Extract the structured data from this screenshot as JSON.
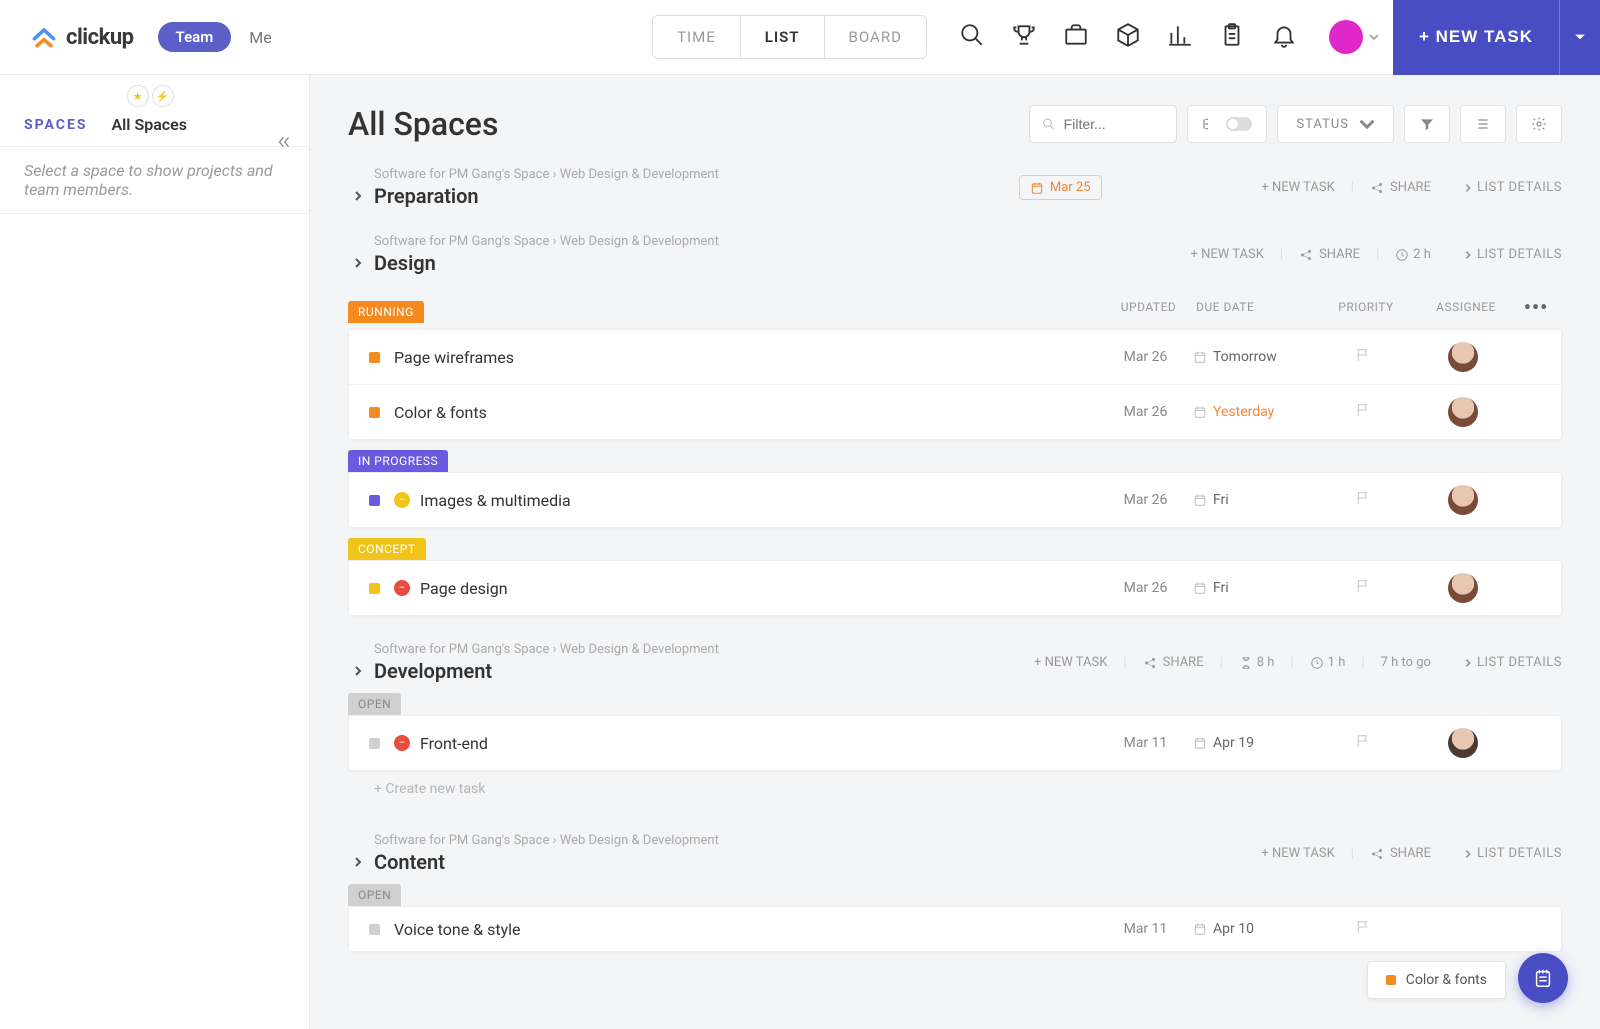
{
  "app": {
    "name": "clickup"
  },
  "topnav": {
    "team": "Team",
    "me": "Me",
    "views": [
      "TIME",
      "LIST",
      "BOARD"
    ],
    "active_view": "LIST",
    "newtask": "+ NEW TASK"
  },
  "sidebar": {
    "tabs": {
      "spaces": "SPACES",
      "all": "All Spaces"
    },
    "hint": "Select a space to show projects and team members."
  },
  "page": {
    "title": "All Spaces",
    "filter_placeholder": "Filter...",
    "status_label": "STATUS"
  },
  "common": {
    "new_task": "+ NEW TASK",
    "share": "SHARE",
    "details": "LIST DETAILS",
    "create": "+   Create new task",
    "breadcrumb": "Software for PM Gang's Space  ›  Web Design & Development"
  },
  "columns": {
    "updated": "UPDATED",
    "due": "DUE DATE",
    "priority": "PRIORITY",
    "assignee": "ASSIGNEE"
  },
  "sections": [
    {
      "name": "Preparation",
      "date_pill": "Mar 25"
    },
    {
      "name": "Design",
      "time": "2 h",
      "groups": [
        {
          "status": "RUNNING",
          "color": "#f58b1f",
          "tasks": [
            {
              "dot": "#f58b1f",
              "name": "Page wireframes",
              "updated": "Mar 26",
              "due": "Tomorrow"
            },
            {
              "dot": "#f58b1f",
              "name": "Color & fonts",
              "updated": "Mar 26",
              "due": "Yesterday",
              "overdue": true
            }
          ]
        },
        {
          "status": "IN PROGRESS",
          "color": "#6a5ae0",
          "tasks": [
            {
              "dot": "#6a5ae0",
              "badge": "#f0c419",
              "name": "Images & multimedia",
              "updated": "Mar 26",
              "due": "Fri"
            }
          ]
        },
        {
          "status": "CONCEPT",
          "color": "#f0c419",
          "textcolor": "#fff",
          "tasks": [
            {
              "dot": "#f0c419",
              "badge": "#e74c3c",
              "name": "Page design",
              "updated": "Mar 26",
              "due": "Fri"
            }
          ]
        }
      ]
    },
    {
      "name": "Development",
      "time": "1 h",
      "est": "8 h",
      "remain": "7 h to go",
      "groups": [
        {
          "status": "OPEN",
          "color": "#d0d0d0",
          "textcolor": "#888",
          "tasks": [
            {
              "dot": "#d0d0d0",
              "badge": "#e74c3c",
              "name": "Front-end",
              "updated": "Mar 11",
              "due": "Apr 19",
              "male": true
            }
          ],
          "create": true
        }
      ]
    },
    {
      "name": "Content",
      "groups": [
        {
          "status": "OPEN",
          "color": "#d0d0d0",
          "textcolor": "#888",
          "tasks": [
            {
              "dot": "#d0d0d0",
              "name": "Voice tone & style",
              "updated": "Mar 11",
              "due": "Apr 10",
              "noavatar": true
            }
          ]
        }
      ]
    }
  ],
  "float_card": {
    "dot": "#f58b1f",
    "text": "Color & fonts"
  }
}
